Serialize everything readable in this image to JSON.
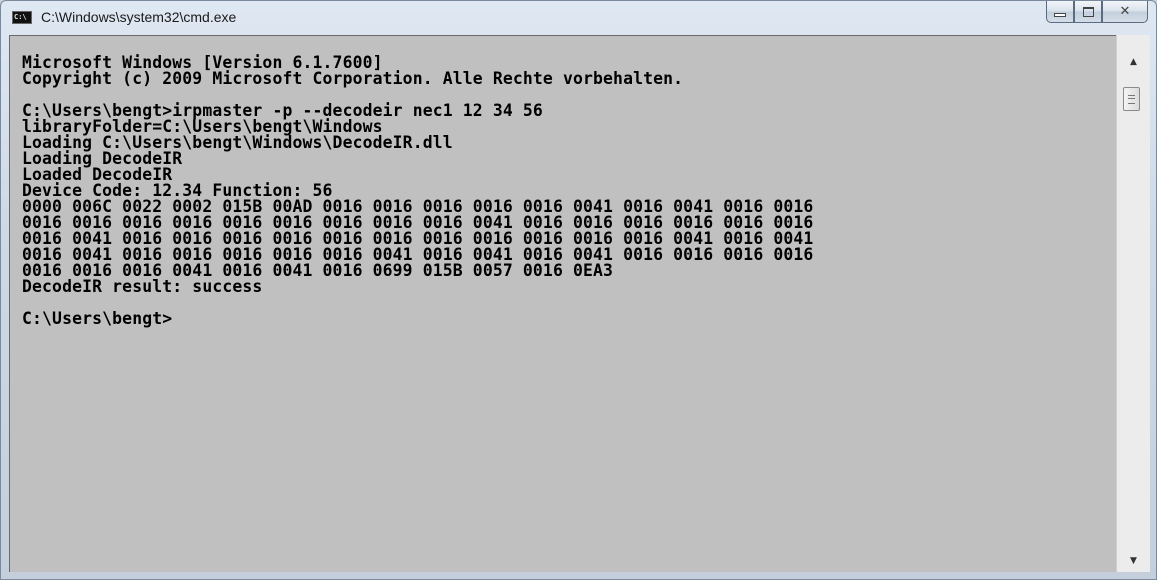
{
  "window": {
    "title": "C:\\Windows\\system32\\cmd.exe",
    "icon": "cmd-icon",
    "icon_text": "C:\\"
  },
  "caption_buttons": {
    "minimize_icon": "minimize-icon",
    "maximize_icon": "maximize-icon",
    "close_icon": "close-icon",
    "close_glyph": "✕"
  },
  "console": {
    "background_color": "#c0c0c0",
    "text_color": "#000000",
    "lines": [
      "Microsoft Windows [Version 6.1.7600]",
      "Copyright (c) 2009 Microsoft Corporation. Alle Rechte vorbehalten.",
      "",
      "C:\\Users\\bengt>irpmaster -p --decodeir nec1 12 34 56",
      "libraryFolder=C:\\Users\\bengt\\Windows",
      "Loading C:\\Users\\bengt\\Windows\\DecodeIR.dll",
      "Loading DecodeIR",
      "Loaded DecodeIR",
      "Device Code: 12.34 Function: 56",
      "0000 006C 0022 0002 015B 00AD 0016 0016 0016 0016 0016 0041 0016 0041 0016 0016",
      "0016 0016 0016 0016 0016 0016 0016 0016 0016 0041 0016 0016 0016 0016 0016 0016",
      "0016 0041 0016 0016 0016 0016 0016 0016 0016 0016 0016 0016 0016 0041 0016 0041",
      "0016 0041 0016 0016 0016 0016 0016 0041 0016 0041 0016 0041 0016 0016 0016 0016",
      "0016 0016 0016 0041 0016 0041 0016 0699 015B 0057 0016 0EA3",
      "DecodeIR result: success",
      "",
      "C:\\Users\\bengt>"
    ]
  },
  "scrollbar": {
    "up_icon": "scroll-up-icon",
    "down_icon": "scroll-down-icon",
    "up_glyph": "▲",
    "down_glyph": "▼"
  }
}
